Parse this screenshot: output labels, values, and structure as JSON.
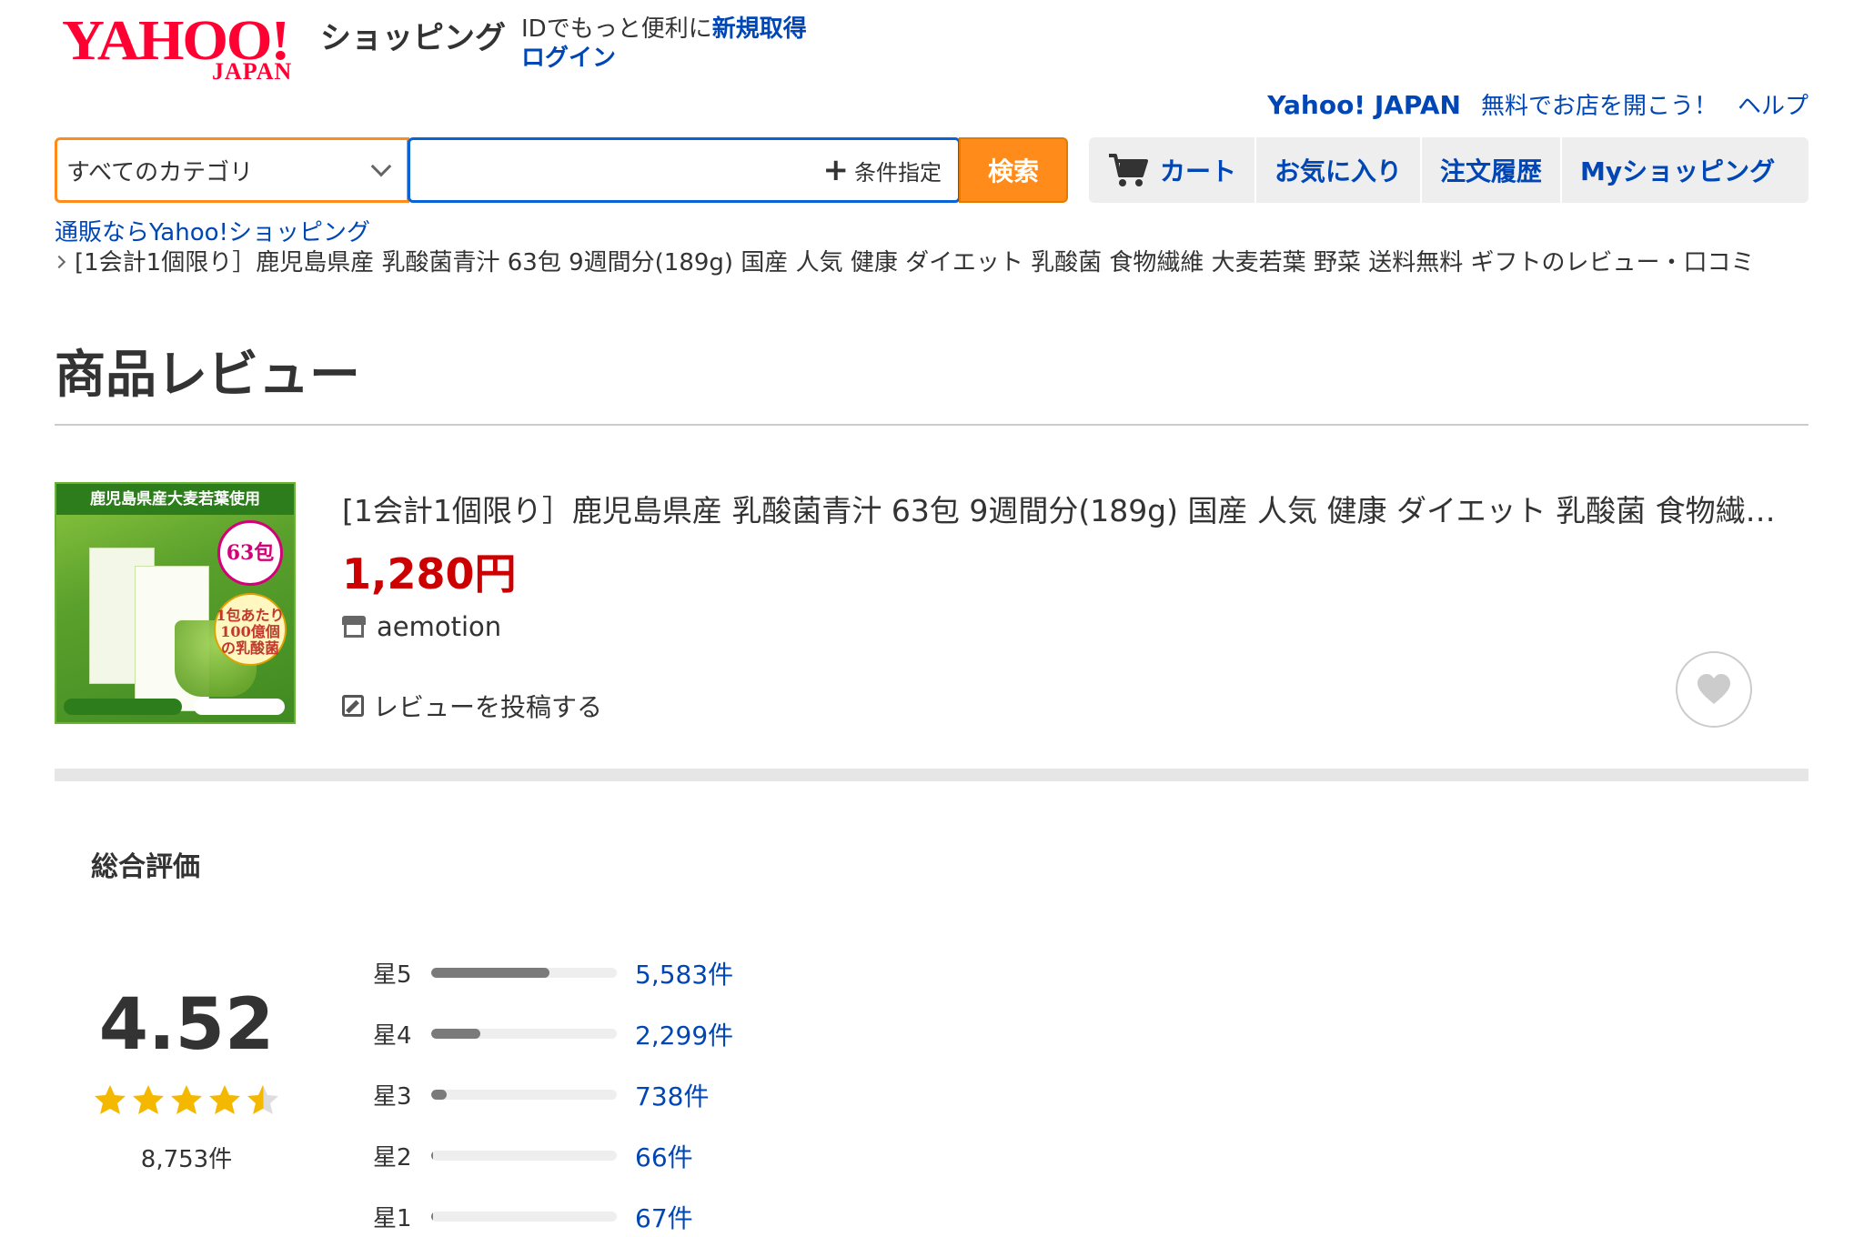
{
  "header": {
    "logo_text": "YAHOO!",
    "logo_sub": "JAPAN",
    "service": "ショッピング",
    "id_prompt": "IDでもっと便利に",
    "id_signup": "新規取得",
    "id_login": "ログイン",
    "top_links": {
      "yahoo_japan": "Yahoo! JAPAN",
      "open_store": "無料でお店を開こう！",
      "help": "ヘルプ"
    }
  },
  "search": {
    "category_selected": "すべてのカテゴリ",
    "placeholder": "",
    "condition_label": "条件指定",
    "button_label": "検索"
  },
  "nav": {
    "cart": "カート",
    "favorites": "お気に入り",
    "order_history": "注文履歴",
    "my_shopping": "Myショッピング"
  },
  "breadcrumb": {
    "root": "通販ならYahoo!ショッピング",
    "current": "[1会計1個限り］鹿児島県産 乳酸菌青汁 63包 9週間分(189g) 国産 人気 健康 ダイエット 乳酸菌 食物繊維 大麦若葉 野菜 送料無料 ギフトのレビュー・口コミ"
  },
  "page_title": "商品レビュー",
  "product": {
    "image_banner": "鹿児島県産大麦若葉使用",
    "image_badge": "63包分",
    "image_badge2": "1包あたり100億個の乳酸菌",
    "name": "[1会計1個限り］鹿児島県産 乳酸菌青汁 63包 9週間分(189g) 国産 人気 健康 ダイエット 乳酸菌 食物繊維 大麦若葉 野菜 送料無料 ギフト",
    "price": "1,280円",
    "store": "aemotion",
    "post_review": "レビューを投稿する"
  },
  "rating": {
    "label": "総合評価",
    "average": "4.52",
    "stars_value": 4.52,
    "total_count": "8,753件",
    "distribution": [
      {
        "label": "星5",
        "count": "5,583件",
        "fraction": 0.638
      },
      {
        "label": "星4",
        "count": "2,299件",
        "fraction": 0.263
      },
      {
        "label": "星3",
        "count": "738件",
        "fraction": 0.084
      },
      {
        "label": "星2",
        "count": "66件",
        "fraction": 0.008
      },
      {
        "label": "星1",
        "count": "67件",
        "fraction": 0.008
      }
    ]
  },
  "colors": {
    "accent_orange": "#ff8c1a",
    "link_blue": "#0046b4",
    "price_red": "#cc0000",
    "star_gold": "#f5b800",
    "logo_red": "#ff0033"
  },
  "icons": {
    "cart": "cart-icon",
    "store": "store-icon",
    "edit": "pencil-icon",
    "favorite": "heart-icon",
    "dropdown": "chevron-down-icon",
    "add": "plus-icon"
  }
}
